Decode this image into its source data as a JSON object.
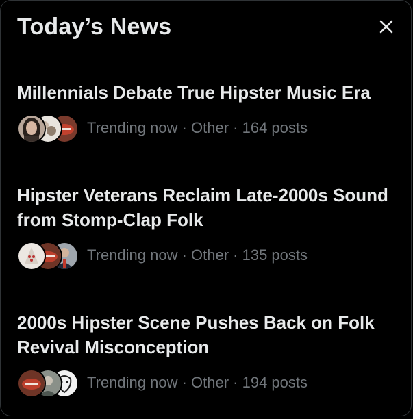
{
  "modal": {
    "title": "Today’s News",
    "close_icon": "close-icon"
  },
  "colors": {
    "background": "#000000",
    "text_primary": "#e7e9ea",
    "text_secondary": "#71767b"
  },
  "items": [
    {
      "headline": "Millennials Debate True Hipster Music Era",
      "meta": "Trending now · Other · 164 posts",
      "avatars": [
        "avatar-woman-dark-hair",
        "avatar-flowers",
        "avatar-red-lips"
      ]
    },
    {
      "headline": "Hipster Veterans Reclaim Late-2000s Sound from Stomp-Clap Folk",
      "meta": "Trending now · Other · 135 posts",
      "avatars": [
        "avatar-cartoon-figure",
        "avatar-red-lips",
        "avatar-man-suit"
      ]
    },
    {
      "headline": "2000s Hipster Scene Pushes Back on Folk Revival Misconception",
      "meta": "Trending now · Other · 194 posts",
      "avatars": [
        "avatar-red-lips",
        "avatar-gray-portrait",
        "avatar-sketch-face"
      ]
    }
  ]
}
